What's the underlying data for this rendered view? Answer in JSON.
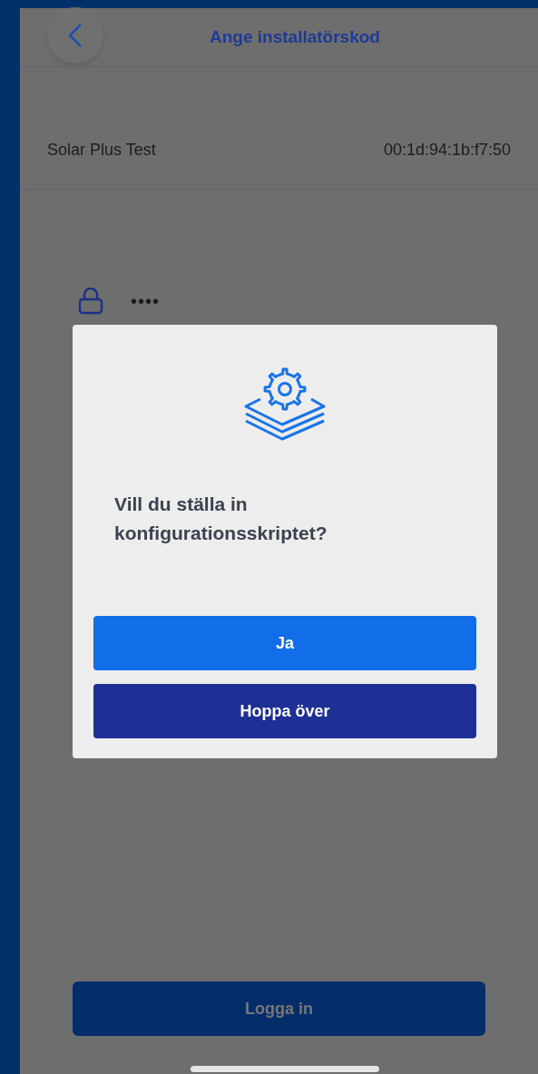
{
  "header": {
    "title": "Ange installatörskod"
  },
  "device": {
    "name": "Solar Plus Test",
    "address": "00:1d:94:1b:f7:50"
  },
  "code_field": {
    "value": "••••"
  },
  "login_button": {
    "label": "Logga in"
  },
  "dialog": {
    "message": "Vill du ställa in konfigurationsskriptet?",
    "buttons": [
      {
        "label": "Ja",
        "kind": "primary"
      },
      {
        "label": "Hoppa över",
        "kind": "secondary"
      }
    ]
  }
}
